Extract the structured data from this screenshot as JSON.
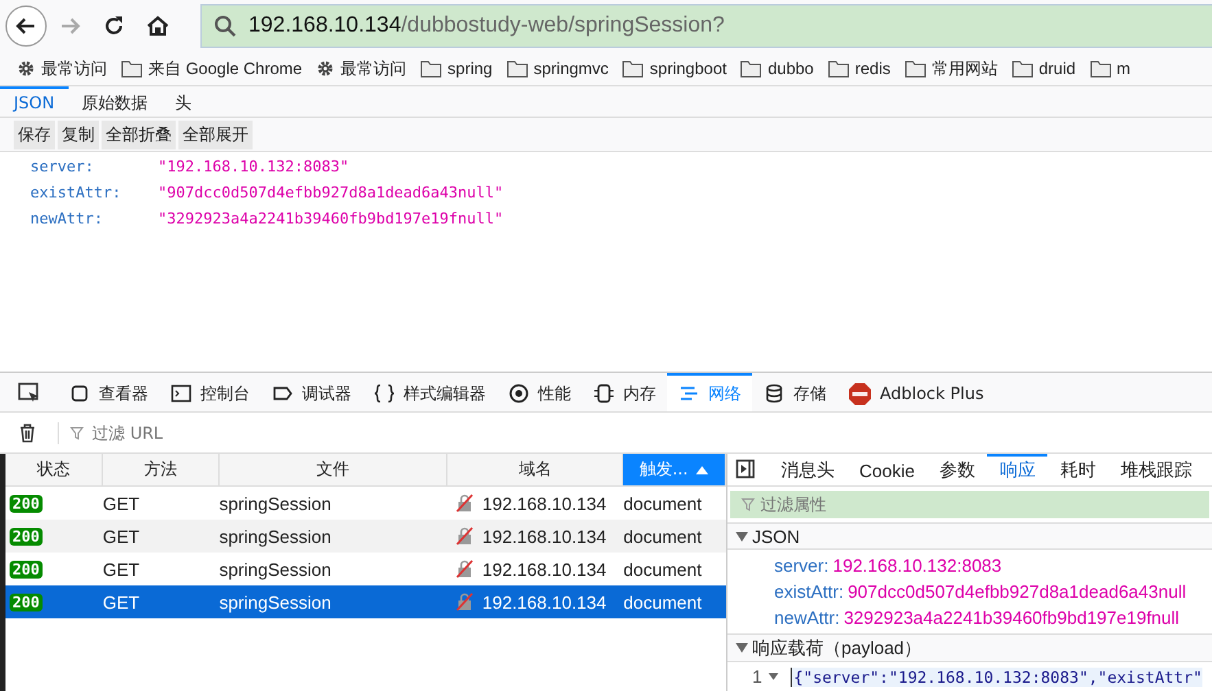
{
  "nav": {
    "buttons": [
      {
        "kind": "back",
        "disabled": false
      },
      {
        "kind": "forward",
        "disabled": true
      },
      {
        "kind": "reload",
        "disabled": false
      },
      {
        "kind": "home",
        "disabled": false
      }
    ],
    "url": {
      "host": "192.168.10.134",
      "path": "/dubbostudy-web/springSession?"
    }
  },
  "bookmarks": [
    {
      "label": "最常访问",
      "kind": "gear"
    },
    {
      "label": "来自 Google Chrome",
      "kind": "folder"
    },
    {
      "label": "最常访问",
      "kind": "gear"
    },
    {
      "label": "spring",
      "kind": "folder"
    },
    {
      "label": "springmvc",
      "kind": "folder"
    },
    {
      "label": "springboot",
      "kind": "folder"
    },
    {
      "label": "dubbo",
      "kind": "folder"
    },
    {
      "label": "redis",
      "kind": "folder"
    },
    {
      "label": "常用网站",
      "kind": "folder"
    },
    {
      "label": "druid",
      "kind": "folder"
    },
    {
      "label": "m",
      "kind": "folder"
    }
  ],
  "viewer": {
    "tabs": [
      {
        "label": "JSON",
        "selected": true
      },
      {
        "label": "原始数据",
        "selected": false
      },
      {
        "label": "头",
        "selected": false
      }
    ],
    "actions": [
      "保存",
      "复制",
      "全部折叠",
      "全部展开"
    ],
    "entries": [
      {
        "key": "server:",
        "value": "\"192.168.10.132:8083\""
      },
      {
        "key": "existAttr:",
        "value": "\"907dcc0d507d4efbb927d8a1dead6a43null\""
      },
      {
        "key": "newAttr:",
        "value": "\"3292923a4a2241b39460fb9bd197e19fnull\""
      }
    ]
  },
  "devtools": {
    "tabs": [
      {
        "label": "查看器",
        "kind": "inspector",
        "selected": false
      },
      {
        "label": "控制台",
        "kind": "console",
        "selected": false
      },
      {
        "label": "调试器",
        "kind": "debugger",
        "selected": false
      },
      {
        "label": "样式编辑器",
        "kind": "style",
        "selected": false
      },
      {
        "label": "性能",
        "kind": "performance",
        "selected": false
      },
      {
        "label": "内存",
        "kind": "memory",
        "selected": false
      },
      {
        "label": "网络",
        "kind": "network",
        "selected": true
      },
      {
        "label": "存储",
        "kind": "storage",
        "selected": false
      },
      {
        "label": "Adblock Plus",
        "kind": "adblock",
        "selected": false
      }
    ],
    "filter": {
      "placeholder": "过滤 URL"
    }
  },
  "requests": {
    "columns": [
      {
        "label": "状态",
        "sorted": false
      },
      {
        "label": "方法",
        "sorted": false
      },
      {
        "label": "文件",
        "sorted": false
      },
      {
        "label": "域名",
        "sorted": false
      },
      {
        "label": "触发...",
        "sorted": true
      }
    ],
    "rows": [
      {
        "status": "200",
        "method": "GET",
        "file": "springSession",
        "domain": "192.168.10.134",
        "trigger": "document",
        "selected": false
      },
      {
        "status": "200",
        "method": "GET",
        "file": "springSession",
        "domain": "192.168.10.134",
        "trigger": "document",
        "selected": false
      },
      {
        "status": "200",
        "method": "GET",
        "file": "springSession",
        "domain": "192.168.10.134",
        "trigger": "document",
        "selected": false
      },
      {
        "status": "200",
        "method": "GET",
        "file": "springSession",
        "domain": "192.168.10.134",
        "trigger": "document",
        "selected": true
      }
    ]
  },
  "details": {
    "tabs": [
      {
        "label": "消息头",
        "selected": false
      },
      {
        "label": "Cookie",
        "selected": false
      },
      {
        "label": "参数",
        "selected": false
      },
      {
        "label": "响应",
        "selected": true
      },
      {
        "label": "耗时",
        "selected": false
      },
      {
        "label": "堆栈跟踪",
        "selected": false
      }
    ],
    "filter": {
      "placeholder": "过滤属性"
    },
    "json_section": {
      "title": "JSON",
      "expanded": true,
      "entries": [
        {
          "key": "server:",
          "value": "192.168.10.132:8083"
        },
        {
          "key": "existAttr:",
          "value": "907dcc0d507d4efbb927d8a1dead6a43null"
        },
        {
          "key": "newAttr:",
          "value": "3292923a4a2241b39460fb9bd197e19fnull"
        }
      ]
    },
    "payload_section": {
      "title": "响应载荷（payload）",
      "expanded": true,
      "line_number": "1",
      "code": "{\"server\":\"192.168.10.132:8083\",\"existAttr\""
    }
  }
}
